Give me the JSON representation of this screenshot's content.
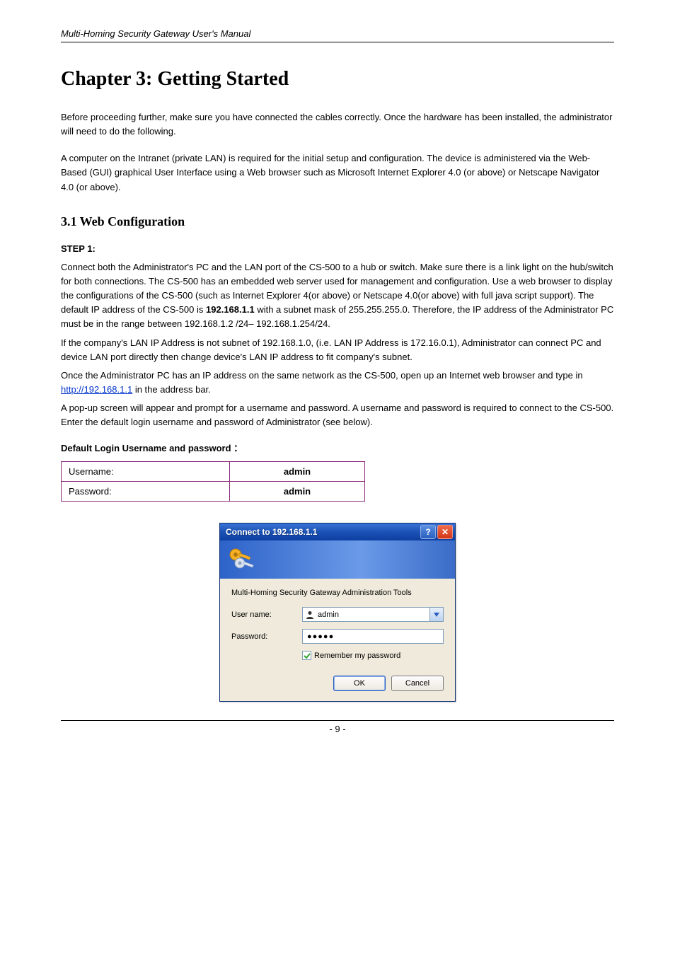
{
  "header": {
    "left": "Multi-Homing Security Gateway User's Manual",
    "right": ""
  },
  "chapter_title": "Chapter 3: Getting Started",
  "intro_1": "Before proceeding further, make sure you have connected the cables correctly. Once the hardware has been installed, the administrator will need to do the following.",
  "intro_2": "A computer on the Intranet (private LAN) is required for the initial setup and configuration. The device is administered via the Web-Based (GUI) graphical User Interface using a Web browser such as Microsoft Internet Explorer 4.0 (or above) or Netscape Navigator 4.0 (or above).",
  "section_title": "3.1 Web Configuration",
  "step1": "STEP 1:",
  "step1_text": "Connect both the Administrator's PC and the LAN port of the CS-500 to a hub or switch. Make sure there is a link light on the hub/switch for both connections. The CS-500 has an embedded web server used for management and configuration. Use a web browser to display the configurations of the CS-500 (such as Internet Explorer 4(or above) or Netscape 4.0(or above) with full java script support). The default IP address of the CS-500 is",
  "step1_bold": "192.168.1.1",
  "step1_tail": " with a subnet mask of 255.255.255.0. Therefore, the IP address of the Administrator PC must be in the range between 192.168.1.2 /24– 192.168.1.254/24.",
  "step1_sub1": "If the company's LAN IP Address is not subnet of 192.168.1.0, (i.e. LAN IP Address is 172.16.0.1), Administrator can connect PC and device LAN port directly then change device's LAN IP address to fit company's subnet.",
  "step1_sub2_a": "Once the Administrator PC has an IP address on the same network as the CS-500, open up an Internet web browser and type in ",
  "step1_link": "http://192.168.1.1",
  "step1_sub2_b": " in the address bar.",
  "step1_sub3": "A pop-up screen will appear and prompt for a username and password. A username and password is required to connect to the CS-500. Enter the default login username and password of Administrator (see below).",
  "cred_label": "Default Login Username and password ：",
  "cred_table": {
    "r1c1": "Username:",
    "r1c2": "admin",
    "r2c1": "Password:",
    "r2c2": "admin"
  },
  "dialog": {
    "title": "Connect to 192.168.1.1",
    "realm": "Multi-Homing Security Gateway Administration Tools",
    "username_label": "User name:",
    "username_value": "admin",
    "password_label": "Password:",
    "password_mask": "●●●●●",
    "remember": "Remember my password",
    "ok": "OK",
    "cancel": "Cancel"
  },
  "footer": "- 9 -"
}
